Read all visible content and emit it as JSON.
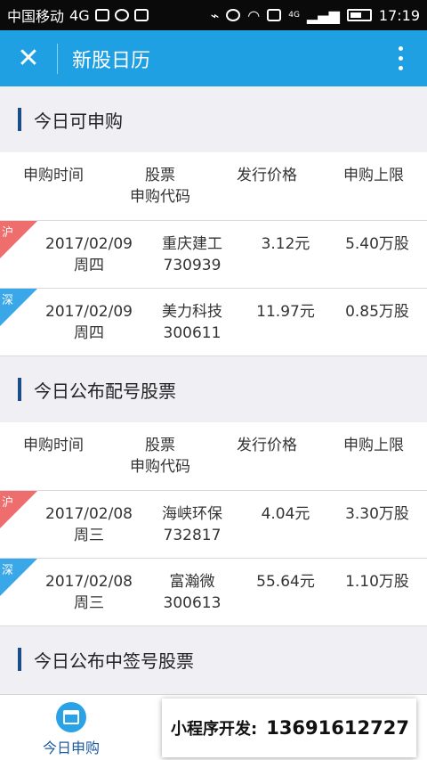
{
  "status_bar": {
    "carrier": "中国移动",
    "network": "4G",
    "network_small": "4G",
    "time": "17:19"
  },
  "app_bar": {
    "close_glyph": "✕",
    "title": "新股日历"
  },
  "headers": {
    "c1": "申购时间",
    "c2_line1": "股票",
    "c2_line2": "申购代码",
    "c3": "发行价格",
    "c4": "申购上限"
  },
  "sections": [
    {
      "title": "今日可申购",
      "rows": [
        {
          "market": "沪",
          "date": "2017/02/09",
          "weekday": "周四",
          "name": "重庆建工",
          "code": "730939",
          "price": "3.12元",
          "limit": "5.40万股"
        },
        {
          "market": "深",
          "date": "2017/02/09",
          "weekday": "周四",
          "name": "美力科技",
          "code": "300611",
          "price": "11.97元",
          "limit": "0.85万股"
        }
      ]
    },
    {
      "title": "今日公布配号股票",
      "rows": [
        {
          "market": "沪",
          "date": "2017/02/08",
          "weekday": "周三",
          "name": "海峡环保",
          "code": "732817",
          "price": "4.04元",
          "limit": "3.30万股"
        },
        {
          "market": "深",
          "date": "2017/02/08",
          "weekday": "周三",
          "name": "富瀚微",
          "code": "300613",
          "price": "55.64元",
          "limit": "1.10万股"
        }
      ]
    },
    {
      "title": "今日公布中签号股票"
    }
  ],
  "tab_bar": {
    "tab1_label": "今日申购"
  },
  "promo": {
    "label": "小程序开发:",
    "phone": "13691612727"
  },
  "colors": {
    "accent": "#1fa0e3",
    "sh_tag": "#ee6d6d",
    "sz_tag": "#3aa7e9"
  }
}
